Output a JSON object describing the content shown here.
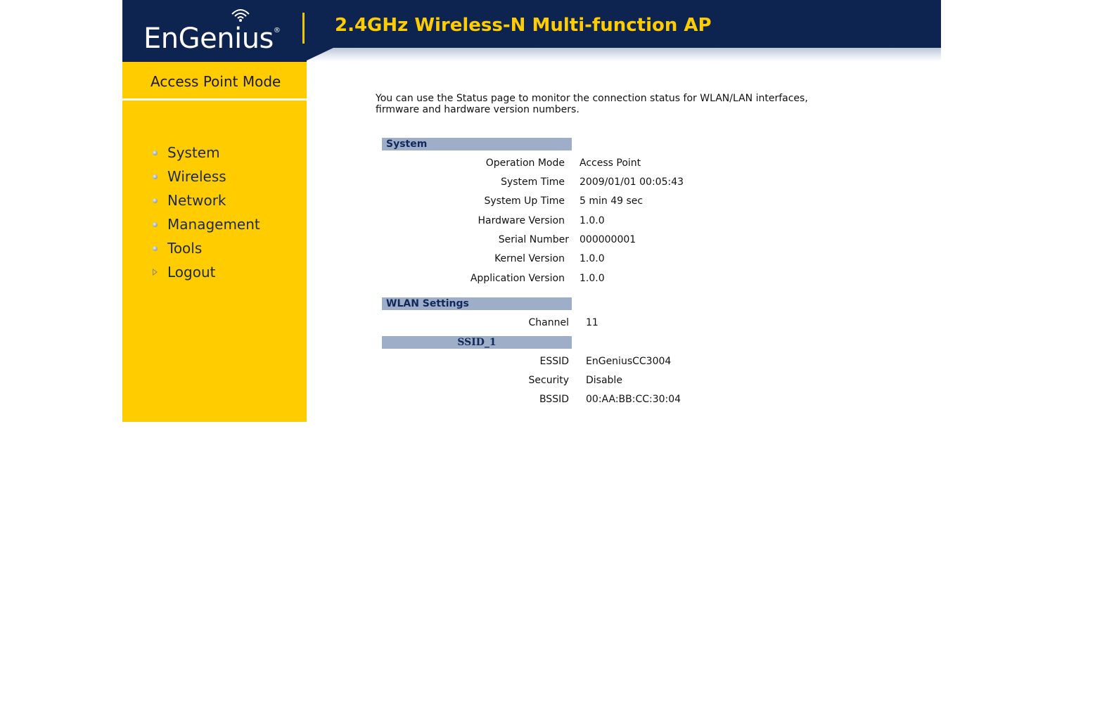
{
  "header": {
    "logo_text": "EnGenius",
    "logo_mark": "®",
    "product_title": "2.4GHz Wireless-N Multi-function AP"
  },
  "sidebar": {
    "mode_label": "Access Point Mode",
    "items": [
      {
        "label": "System",
        "icon": "bullet-icon"
      },
      {
        "label": "Wireless",
        "icon": "bullet-icon"
      },
      {
        "label": "Network",
        "icon": "bullet-icon"
      },
      {
        "label": "Management",
        "icon": "bullet-icon"
      },
      {
        "label": "Tools",
        "icon": "bullet-icon"
      },
      {
        "label": "Logout",
        "icon": "arrow-right-icon"
      }
    ]
  },
  "main": {
    "intro_line1": "You can use the Status page to monitor the connection status for WLAN/LAN interfaces,",
    "intro_line2": "firmware and hardware version numbers.",
    "system": {
      "title": "System",
      "rows": [
        {
          "label": "Operation Mode",
          "value": "Access Point"
        },
        {
          "label": "System Time",
          "value": "2009/01/01 00:05:43"
        },
        {
          "label": "System Up Time",
          "value": "5 min 49 sec"
        },
        {
          "label": "Hardware Version",
          "value": "1.0.0"
        },
        {
          "label": "Serial Number",
          "value": "000000001"
        },
        {
          "label": "Kernel Version",
          "value": "1.0.0"
        },
        {
          "label": "Application Version",
          "value": "1.0.0"
        }
      ]
    },
    "wlan": {
      "title": "WLAN Settings",
      "channel_label": "Channel",
      "channel_value": "11",
      "ssid_title": "SSID_1",
      "rows": [
        {
          "label": "ESSID",
          "value": "EnGeniusCC3004"
        },
        {
          "label": "Security",
          "value": "Disable"
        },
        {
          "label": "BSSID",
          "value": "00:AA:BB:CC:30:04"
        }
      ]
    }
  },
  "colors": {
    "header_bg": "#0d2350",
    "title_yellow": "#ffcc00",
    "sidebar_bg": "#ffcc00",
    "section_bar": "#9eaec8",
    "section_text": "#12285a"
  }
}
